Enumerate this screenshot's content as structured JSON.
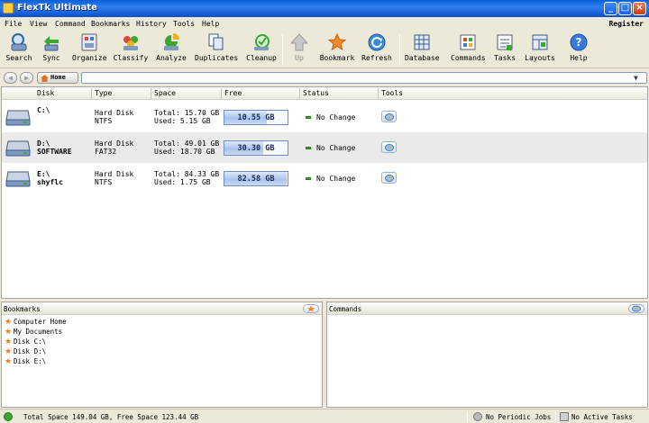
{
  "window": {
    "title": "FlexTk Ultimate"
  },
  "menu": {
    "items": [
      "File",
      "View",
      "Command",
      "Bookmarks",
      "History",
      "Tools",
      "Help"
    ],
    "register": "Register"
  },
  "toolbar": {
    "buttons": [
      "Search",
      "Sync",
      "Organize",
      "Classify",
      "Analyze",
      "Duplicates",
      "Cleanup",
      "Up",
      "Bookmark",
      "Refresh",
      "Database",
      "Commands",
      "Tasks",
      "Layouts",
      "Help"
    ]
  },
  "address": {
    "home_label": "Home",
    "path_value": ""
  },
  "columns": [
    "Disk",
    "Type",
    "Space",
    "Free",
    "Status",
    "Tools"
  ],
  "disks": [
    {
      "name": "C:\\",
      "label": "",
      "type": "Hard Disk",
      "fs": "NTFS",
      "total": "Total: 15.70 GB",
      "used": "Used:  5.15 GB",
      "free": "10.55 GB",
      "free_fraction": 0.67,
      "status": "No Change"
    },
    {
      "name": "D:\\",
      "label": "SOFTWARE",
      "type": "Hard Disk",
      "fs": "FAT32",
      "total": "Total: 49.01 GB",
      "used": "Used: 18.70 GB",
      "free": "30.30 GB",
      "free_fraction": 0.62,
      "status": "No Change"
    },
    {
      "name": "E:\\",
      "label": "shyflc",
      "type": "Hard Disk",
      "fs": "NTFS",
      "total": "Total: 84.33 GB",
      "used": "Used:  1.75 GB",
      "free": "82.58 GB",
      "free_fraction": 0.98,
      "status": "No Change"
    }
  ],
  "bookmarks": {
    "title": "Bookmarks",
    "items": [
      "Computer Home",
      "My Documents",
      "Disk C:\\",
      "Disk D:\\",
      "Disk E:\\"
    ]
  },
  "commands": {
    "title": "Commands"
  },
  "status": {
    "space": "Total Space 149.04 GB, Free Space 123.44 GB",
    "periodic": "No Periodic Jobs",
    "tasks": "No Active Tasks"
  },
  "colors": {
    "titlebar": "#0a5fd8",
    "accent": "#ef7a1a",
    "status_ok": "#3aa830"
  }
}
